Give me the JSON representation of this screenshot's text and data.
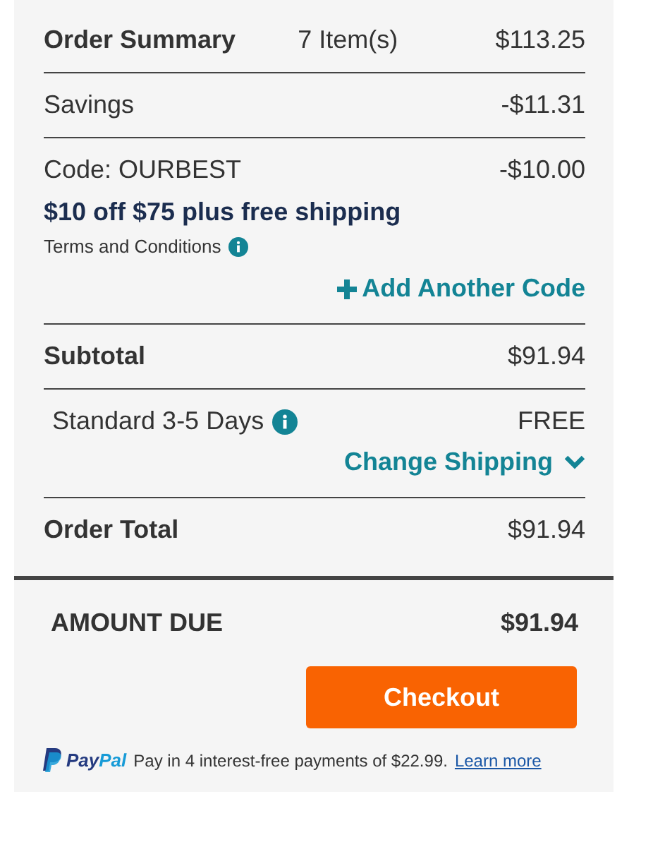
{
  "order_summary": {
    "title": "Order Summary",
    "item_count": "7 Item(s)",
    "amount": "$113.25"
  },
  "savings": {
    "label": "Savings",
    "amount": "-$11.31"
  },
  "promo": {
    "code_label": "Code: OURBEST",
    "amount": "-$10.00",
    "headline": "$10 off $75 plus free shipping",
    "terms": "Terms and Conditions"
  },
  "add_code_link": "Add Another Code",
  "subtotal": {
    "label": "Subtotal",
    "amount": "$91.94"
  },
  "shipping": {
    "method": "Standard 3-5 Days",
    "price": "FREE",
    "change_link": "Change Shipping"
  },
  "order_total": {
    "label": "Order Total",
    "amount": "$91.94"
  },
  "amount_due": {
    "label": "AMOUNT DUE",
    "amount": "$91.94"
  },
  "checkout_button": "Checkout",
  "paypal": {
    "logo": "PayPal",
    "message": "Pay in 4 interest-free payments of $22.99.",
    "link": "Learn more"
  }
}
